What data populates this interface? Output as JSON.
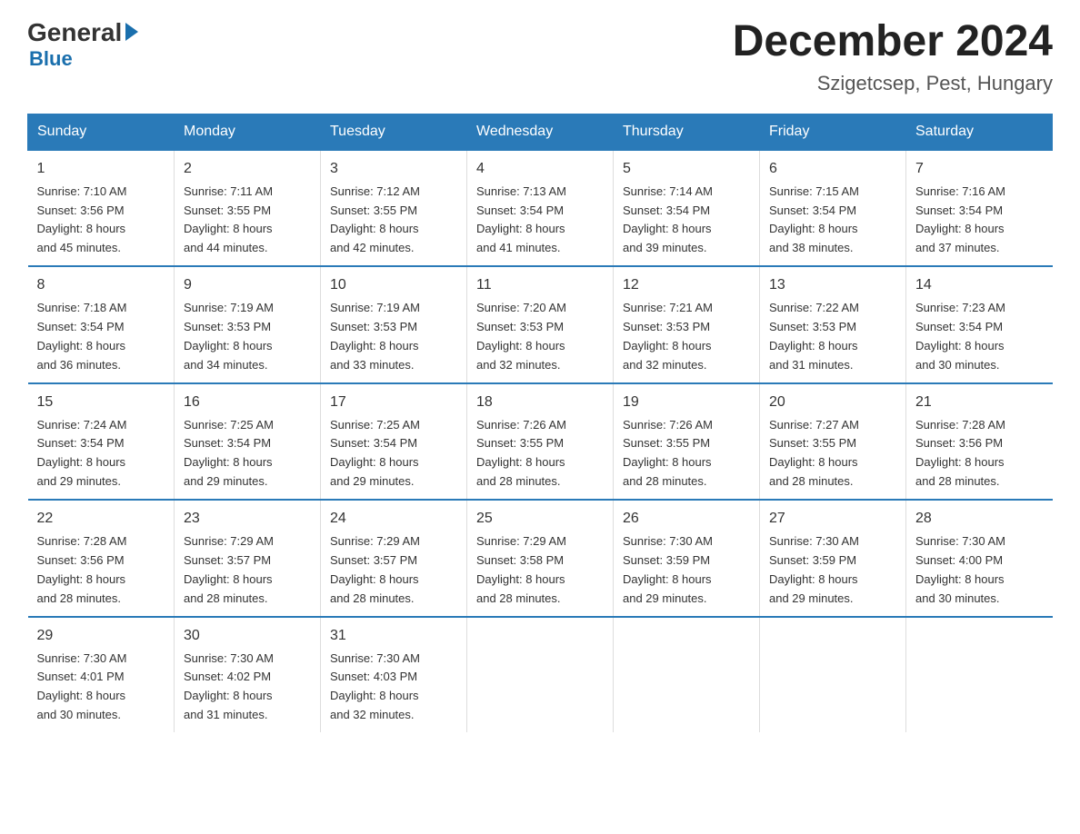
{
  "logo": {
    "general": "General",
    "blue": "Blue"
  },
  "title": "December 2024",
  "subtitle": "Szigetcsep, Pest, Hungary",
  "days_of_week": [
    "Sunday",
    "Monday",
    "Tuesday",
    "Wednesday",
    "Thursday",
    "Friday",
    "Saturday"
  ],
  "weeks": [
    [
      {
        "day": "1",
        "sunrise": "7:10 AM",
        "sunset": "3:56 PM",
        "daylight": "8 hours and 45 minutes."
      },
      {
        "day": "2",
        "sunrise": "7:11 AM",
        "sunset": "3:55 PM",
        "daylight": "8 hours and 44 minutes."
      },
      {
        "day": "3",
        "sunrise": "7:12 AM",
        "sunset": "3:55 PM",
        "daylight": "8 hours and 42 minutes."
      },
      {
        "day": "4",
        "sunrise": "7:13 AM",
        "sunset": "3:54 PM",
        "daylight": "8 hours and 41 minutes."
      },
      {
        "day": "5",
        "sunrise": "7:14 AM",
        "sunset": "3:54 PM",
        "daylight": "8 hours and 39 minutes."
      },
      {
        "day": "6",
        "sunrise": "7:15 AM",
        "sunset": "3:54 PM",
        "daylight": "8 hours and 38 minutes."
      },
      {
        "day": "7",
        "sunrise": "7:16 AM",
        "sunset": "3:54 PM",
        "daylight": "8 hours and 37 minutes."
      }
    ],
    [
      {
        "day": "8",
        "sunrise": "7:18 AM",
        "sunset": "3:54 PM",
        "daylight": "8 hours and 36 minutes."
      },
      {
        "day": "9",
        "sunrise": "7:19 AM",
        "sunset": "3:53 PM",
        "daylight": "8 hours and 34 minutes."
      },
      {
        "day": "10",
        "sunrise": "7:19 AM",
        "sunset": "3:53 PM",
        "daylight": "8 hours and 33 minutes."
      },
      {
        "day": "11",
        "sunrise": "7:20 AM",
        "sunset": "3:53 PM",
        "daylight": "8 hours and 32 minutes."
      },
      {
        "day": "12",
        "sunrise": "7:21 AM",
        "sunset": "3:53 PM",
        "daylight": "8 hours and 32 minutes."
      },
      {
        "day": "13",
        "sunrise": "7:22 AM",
        "sunset": "3:53 PM",
        "daylight": "8 hours and 31 minutes."
      },
      {
        "day": "14",
        "sunrise": "7:23 AM",
        "sunset": "3:54 PM",
        "daylight": "8 hours and 30 minutes."
      }
    ],
    [
      {
        "day": "15",
        "sunrise": "7:24 AM",
        "sunset": "3:54 PM",
        "daylight": "8 hours and 29 minutes."
      },
      {
        "day": "16",
        "sunrise": "7:25 AM",
        "sunset": "3:54 PM",
        "daylight": "8 hours and 29 minutes."
      },
      {
        "day": "17",
        "sunrise": "7:25 AM",
        "sunset": "3:54 PM",
        "daylight": "8 hours and 29 minutes."
      },
      {
        "day": "18",
        "sunrise": "7:26 AM",
        "sunset": "3:55 PM",
        "daylight": "8 hours and 28 minutes."
      },
      {
        "day": "19",
        "sunrise": "7:26 AM",
        "sunset": "3:55 PM",
        "daylight": "8 hours and 28 minutes."
      },
      {
        "day": "20",
        "sunrise": "7:27 AM",
        "sunset": "3:55 PM",
        "daylight": "8 hours and 28 minutes."
      },
      {
        "day": "21",
        "sunrise": "7:28 AM",
        "sunset": "3:56 PM",
        "daylight": "8 hours and 28 minutes."
      }
    ],
    [
      {
        "day": "22",
        "sunrise": "7:28 AM",
        "sunset": "3:56 PM",
        "daylight": "8 hours and 28 minutes."
      },
      {
        "day": "23",
        "sunrise": "7:29 AM",
        "sunset": "3:57 PM",
        "daylight": "8 hours and 28 minutes."
      },
      {
        "day": "24",
        "sunrise": "7:29 AM",
        "sunset": "3:57 PM",
        "daylight": "8 hours and 28 minutes."
      },
      {
        "day": "25",
        "sunrise": "7:29 AM",
        "sunset": "3:58 PM",
        "daylight": "8 hours and 28 minutes."
      },
      {
        "day": "26",
        "sunrise": "7:30 AM",
        "sunset": "3:59 PM",
        "daylight": "8 hours and 29 minutes."
      },
      {
        "day": "27",
        "sunrise": "7:30 AM",
        "sunset": "3:59 PM",
        "daylight": "8 hours and 29 minutes."
      },
      {
        "day": "28",
        "sunrise": "7:30 AM",
        "sunset": "4:00 PM",
        "daylight": "8 hours and 30 minutes."
      }
    ],
    [
      {
        "day": "29",
        "sunrise": "7:30 AM",
        "sunset": "4:01 PM",
        "daylight": "8 hours and 30 minutes."
      },
      {
        "day": "30",
        "sunrise": "7:30 AM",
        "sunset": "4:02 PM",
        "daylight": "8 hours and 31 minutes."
      },
      {
        "day": "31",
        "sunrise": "7:30 AM",
        "sunset": "4:03 PM",
        "daylight": "8 hours and 32 minutes."
      },
      null,
      null,
      null,
      null
    ]
  ],
  "labels": {
    "sunrise": "Sunrise:",
    "sunset": "Sunset:",
    "daylight": "Daylight:"
  }
}
